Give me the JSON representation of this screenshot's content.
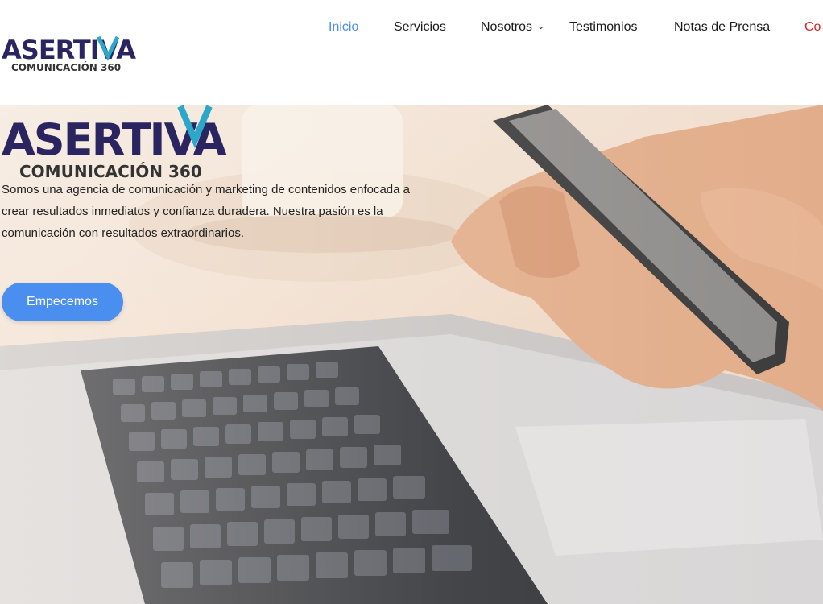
{
  "brand": {
    "logo_text_main": "ASERTIVA",
    "logo_text_sub": "COMUNICACIÓN 360",
    "colors": {
      "navy": "#2a2460",
      "teal": "#2ba7c9",
      "sub": "#333333"
    }
  },
  "nav": {
    "items": [
      {
        "label": "Inicio",
        "active": true
      },
      {
        "label": "Servicios"
      },
      {
        "label": "Nosotros",
        "has_dropdown": true
      },
      {
        "label": "Testimonios"
      },
      {
        "label": "Notas de Prensa"
      },
      {
        "label": "Co",
        "clipped": true
      }
    ],
    "dropdown_icon": "chevron-down-icon",
    "accent": "#4a8ff0",
    "contact_color": "#e02020"
  },
  "hero": {
    "description": "Somos una agencia de comunicación y marketing de contenidos enfocada a crear resultados inmediatos y confianza duradera. Nuestra pasión es la comunicación con resultados extraordinarios.",
    "cta_label": "Empecemos",
    "cta_color": "#4a8ff0"
  }
}
